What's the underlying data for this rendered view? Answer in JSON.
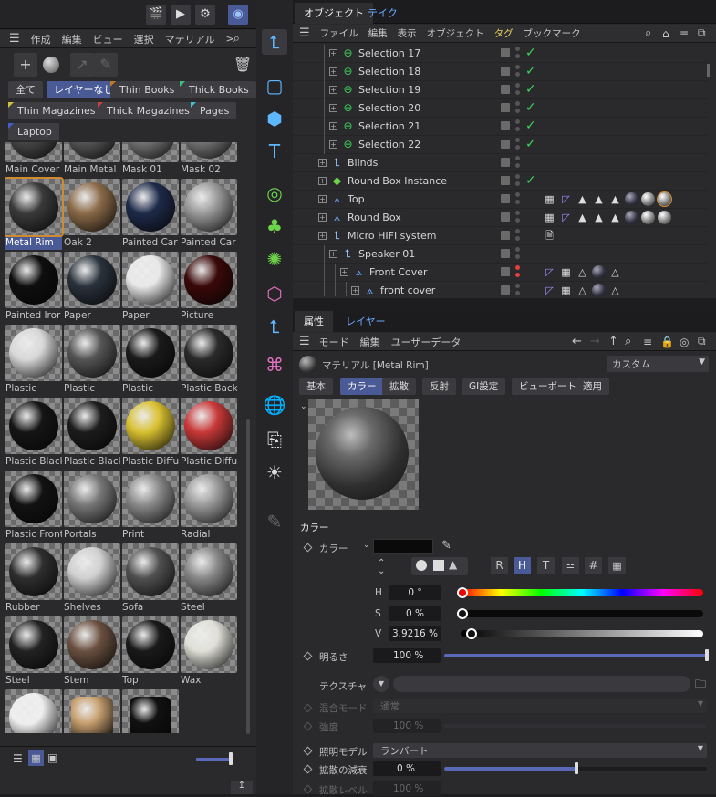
{
  "colors": {
    "accent": "#4a5a96",
    "selection": "#d08a30",
    "check": "#3cd35a",
    "toolbar_icon": "#5fb8ff"
  },
  "left": {
    "menu": [
      "作成",
      "編集",
      "ビュー",
      "選択",
      "マテリアル",
      ">"
    ],
    "filter_tags": [
      "全て",
      "レイヤーなし",
      "Thin Books",
      "Thick Books",
      "Thin Magazines",
      "Thick Magazines",
      "Pages",
      "Laptop"
    ],
    "materials": [
      {
        "name": "Main Cover",
        "color": "#4a4a4a"
      },
      {
        "name": "Main Metal",
        "color": "#5a5a5a"
      },
      {
        "name": "Mask 01",
        "color": "#7a7a7a"
      },
      {
        "name": "Mask 02",
        "color": "#7a7a7a"
      },
      {
        "name": "Metal Rim",
        "color": "#3a3a3a"
      },
      {
        "name": "Oak 2",
        "color": "#8a6a48"
      },
      {
        "name": "Painted Car",
        "color": "#1e2a4a"
      },
      {
        "name": "Painted Car",
        "color": "#9a9a9a"
      },
      {
        "name": "Painted Iror",
        "color": "#0e0e0e"
      },
      {
        "name": "Paper",
        "color": "#2a323c"
      },
      {
        "name": "Paper",
        "color": "#e8e8e8"
      },
      {
        "name": "Picture",
        "color": "#3a0808"
      },
      {
        "name": "Plastic",
        "color": "#d8d8d8"
      },
      {
        "name": "Plastic",
        "color": "#555555"
      },
      {
        "name": "Plastic",
        "color": "#1a1a1a"
      },
      {
        "name": "Plastic Back",
        "color": "#2a2a2a"
      },
      {
        "name": "Plastic Black",
        "color": "#151515"
      },
      {
        "name": "Plastic Black",
        "color": "#1c1c1c"
      },
      {
        "name": "Plastic Diffu",
        "color": "#d8c030"
      },
      {
        "name": "Plastic Diffu",
        "color": "#c83838"
      },
      {
        "name": "Plastic Front",
        "color": "#121212"
      },
      {
        "name": "Portals",
        "color": "#777777"
      },
      {
        "name": "Print",
        "color": "#8a8a8a"
      },
      {
        "name": "Radial",
        "color": "#9a9a9a"
      },
      {
        "name": "Rubber",
        "color": "#2e2e2e"
      },
      {
        "name": "Shelves",
        "color": "#d0d0d0"
      },
      {
        "name": "Sofa",
        "color": "#505050"
      },
      {
        "name": "Steel",
        "color": "#888888"
      },
      {
        "name": "Steel",
        "color": "#222222"
      },
      {
        "name": "Stem",
        "color": "#6a5040"
      },
      {
        "name": "Top",
        "color": "#1a1a1a"
      },
      {
        "name": "Wax",
        "color": "#e0e0d8"
      },
      {
        "name": "",
        "color": "#eeeeee"
      },
      {
        "name": "",
        "color": "#c8a070"
      },
      {
        "name": "",
        "color": "#111111"
      }
    ]
  },
  "objects": {
    "tabs": [
      "オブジェクト",
      "テイク"
    ],
    "menu": [
      "ファイル",
      "編集",
      "表示",
      "オブジェクト",
      "タグ",
      "ブックマーク"
    ],
    "rows": [
      {
        "name": "Selection 17",
        "indent": 1,
        "icon": "selection-icon",
        "check": true
      },
      {
        "name": "Selection 18",
        "indent": 1,
        "icon": "selection-icon",
        "check": true
      },
      {
        "name": "Selection 19",
        "indent": 1,
        "icon": "selection-icon",
        "check": true
      },
      {
        "name": "Selection 20",
        "indent": 1,
        "icon": "selection-icon",
        "check": true
      },
      {
        "name": "Selection 21",
        "indent": 1,
        "icon": "selection-icon",
        "check": true
      },
      {
        "name": "Selection 22",
        "indent": 1,
        "icon": "selection-icon",
        "check": true
      },
      {
        "name": "Blinds",
        "indent": 0,
        "icon": "null-icon",
        "check": false
      },
      {
        "name": "Round Box Instance",
        "indent": 0,
        "icon": "instance-icon",
        "check": true
      },
      {
        "name": "Top",
        "indent": 0,
        "icon": "polygon-icon",
        "check": false,
        "tags": true
      },
      {
        "name": "Round Box",
        "indent": 0,
        "icon": "polygon-icon",
        "check": false,
        "tags": true
      },
      {
        "name": "Micro HIFI system",
        "indent": 0,
        "icon": "null-icon",
        "check": false,
        "note": true
      },
      {
        "name": "Speaker 01",
        "indent": 1,
        "icon": "null-icon",
        "check": false
      },
      {
        "name": "Front Cover",
        "indent": 2,
        "icon": "polygon-icon",
        "check": false,
        "tags2": true,
        "red": true
      },
      {
        "name": "front cover",
        "indent": 3,
        "icon": "polygon-icon",
        "check": false,
        "tags2": true
      }
    ]
  },
  "attributes": {
    "tabs": [
      "属性",
      "レイヤー"
    ],
    "menu": [
      "モード",
      "編集",
      "ユーザーデータ"
    ],
    "material_title": "マテリアル [Metal Rim]",
    "preset": "カスタム",
    "subtabs": [
      "基本",
      "カラー",
      "拡散",
      "反射",
      "GI設定",
      "ビューポート",
      "適用"
    ],
    "section_title": "カラー",
    "color_label": "カラー",
    "mode_letters": [
      "R",
      "H",
      "T"
    ],
    "mode_symbols": [
      "#"
    ],
    "h_label": "H",
    "h_value": "0 °",
    "s_label": "S",
    "s_value": "0 %",
    "v_label": "V",
    "v_value": "3.9216 %",
    "brightness_label": "明るさ",
    "brightness_value": "100 %",
    "brightness_level": 1.0,
    "texture_label": "テクスチャ",
    "blend_label": "混合モード",
    "blend_value": "通常",
    "strength_label": "強度",
    "strength_value": "100 %",
    "model_label": "照明モデル",
    "model_value": "ランバート",
    "falloff_label": "拡散の減衰",
    "falloff_value": "0 %",
    "falloff_level": 0.5,
    "level_label": "拡散レベル",
    "level_value": "100 %"
  }
}
